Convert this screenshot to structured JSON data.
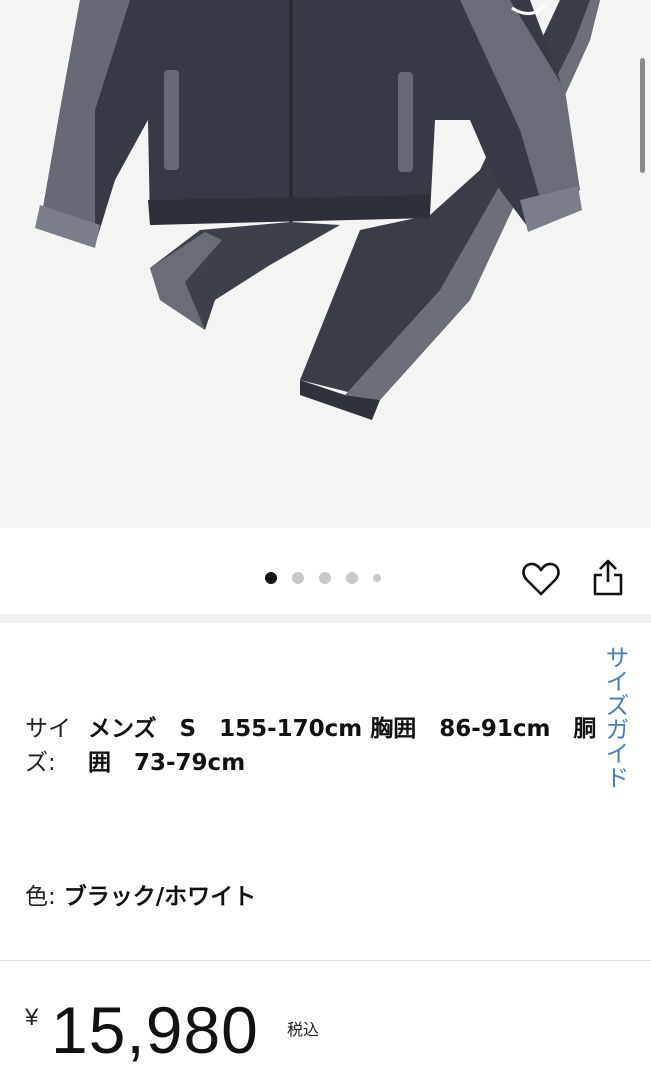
{
  "image": {
    "alt": "track suit product photo",
    "background": "#f4f4f4"
  },
  "gallery": {
    "dot_count": 5,
    "active_index": 0
  },
  "actions": {
    "like_icon": "heart-icon",
    "share_icon": "share-icon"
  },
  "size_guide": {
    "label": "サイズガイド",
    "color": "#4a7fb8"
  },
  "size": {
    "label": "サイズ:",
    "value": "メンズ　S　155-170cm 胸囲　86-91cm　胴囲　73-79cm"
  },
  "color": {
    "label": "色:",
    "value": "ブラック/ホワイト"
  },
  "price": {
    "currency": "¥",
    "amount": "15,980",
    "tax_note": "税込"
  }
}
